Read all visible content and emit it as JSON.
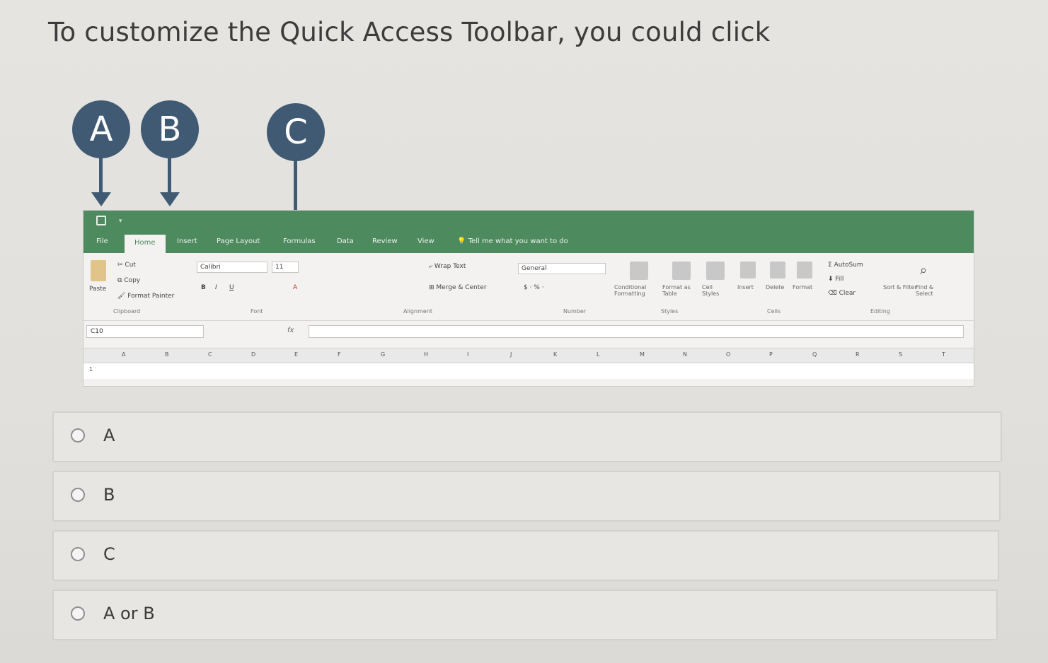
{
  "question": "To customize the Quick Access Toolbar, you could click",
  "callouts": [
    {
      "label": "A"
    },
    {
      "label": "B"
    },
    {
      "label": "C"
    }
  ],
  "excel": {
    "tabs": {
      "file": "File",
      "home": "Home",
      "insert": "Insert",
      "page_layout": "Page Layout",
      "formulas": "Formulas",
      "data": "Data",
      "review": "Review",
      "view": "View",
      "tell_me": "Tell me what you want to do"
    },
    "ribbon": {
      "cut": "Cut",
      "copy": "Copy",
      "paste": "Paste",
      "format_painter": "Format Painter",
      "clipboard": "Clipboard",
      "font_name": "Calibri",
      "font_size": "11",
      "font_group": "Font",
      "wrap_text": "Wrap Text",
      "merge_center": "Merge & Center",
      "alignment_group": "Alignment",
      "number_format": "General",
      "number_group": "Number",
      "conditional_formatting": "Conditional Formatting",
      "format_as_table": "Format as Table",
      "cell_styles": "Cell Styles",
      "styles_group": "Styles",
      "insert": "Insert",
      "delete": "Delete",
      "format": "Format",
      "cells_group": "Cells",
      "autosum": "AutoSum",
      "fill": "Fill",
      "clear": "Clear",
      "sort_filter": "Sort & Filter",
      "find_select": "Find & Select",
      "editing_group": "Editing"
    },
    "name_box": "C10",
    "fx": "fx",
    "columns": [
      "A",
      "B",
      "C",
      "D",
      "E",
      "F",
      "G",
      "H",
      "I",
      "J",
      "K",
      "L",
      "M",
      "N",
      "O",
      "P",
      "Q",
      "R",
      "S",
      "T"
    ],
    "row1": "1"
  },
  "options": [
    {
      "label": "A"
    },
    {
      "label": "B"
    },
    {
      "label": "C"
    },
    {
      "label": "A or B"
    }
  ]
}
